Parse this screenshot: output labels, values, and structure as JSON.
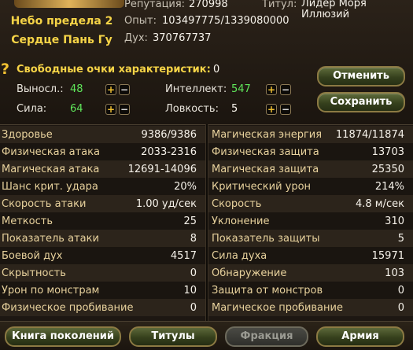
{
  "character": {
    "name": "Небо предела 2",
    "guild": "Сердце Пань Гу",
    "reputation_label": "Репутация:",
    "reputation_value": "270998",
    "experience_label": "Опыт:",
    "experience_value": "103497775/1339080000",
    "spirit_label": "Дух:",
    "spirit_value": "370767737",
    "title_label": "Титул:",
    "title_value": "Лидер Моря Иллюзий"
  },
  "attributes": {
    "free_points_label": "Свободные очки характеристик:",
    "free_points_value": "0",
    "endurance_label": "Выносл.:",
    "endurance_value": "48",
    "strength_label": "Сила:",
    "strength_value": "64",
    "intellect_label": "Интеллект:",
    "intellect_value": "547",
    "agility_label": "Ловкость:",
    "agility_value": "5",
    "plus": "+",
    "minus": "−",
    "value_color": "#5fe65a"
  },
  "actions": {
    "cancel": "Отменить",
    "save": "Сохранить"
  },
  "stats": {
    "rows": [
      {
        "left_label": "Здоровье",
        "left_value": "9386/9386",
        "right_label": "Магическая энергия",
        "right_value": "11874/11874"
      },
      {
        "left_label": "Физическая атака",
        "left_value": "2033-2316",
        "right_label": "Физическая защита",
        "right_value": "13703"
      },
      {
        "left_label": "Магическая атака",
        "left_value": "12691-14096",
        "right_label": "Магическая защита",
        "right_value": "25350"
      },
      {
        "left_label": "Шанс крит. удара",
        "left_value": "20%",
        "right_label": "Критический урон",
        "right_value": "214%"
      },
      {
        "left_label": "Скорость атаки",
        "left_value": "1.00 уд/сек",
        "right_label": "Скорость",
        "right_value": "4.8 м/сек"
      },
      {
        "left_label": "Меткость",
        "left_value": "25",
        "right_label": "Уклонение",
        "right_value": "310"
      },
      {
        "left_label": "Показатель атаки",
        "left_value": "8",
        "right_label": "Показатель защиты",
        "right_value": "5"
      },
      {
        "left_label": "Боевой дух",
        "left_value": "4517",
        "right_label": "Сила духа",
        "right_value": "15971"
      },
      {
        "left_label": "Скрытность",
        "left_value": "0",
        "right_label": "Обнаружение",
        "right_value": "103"
      },
      {
        "left_label": "Урон по монстрам",
        "left_value": "10",
        "right_label": "Защита от монстров",
        "right_value": "0"
      },
      {
        "left_label": "Физическое пробивание",
        "left_value": "0",
        "right_label": "Магическое пробивание",
        "right_value": "0"
      }
    ]
  },
  "bottom_tabs": {
    "generations": "Книга поколений",
    "titles": "Титулы",
    "faction": "Фракция",
    "army": "Армия"
  },
  "icons": {
    "help": "question-icon"
  }
}
